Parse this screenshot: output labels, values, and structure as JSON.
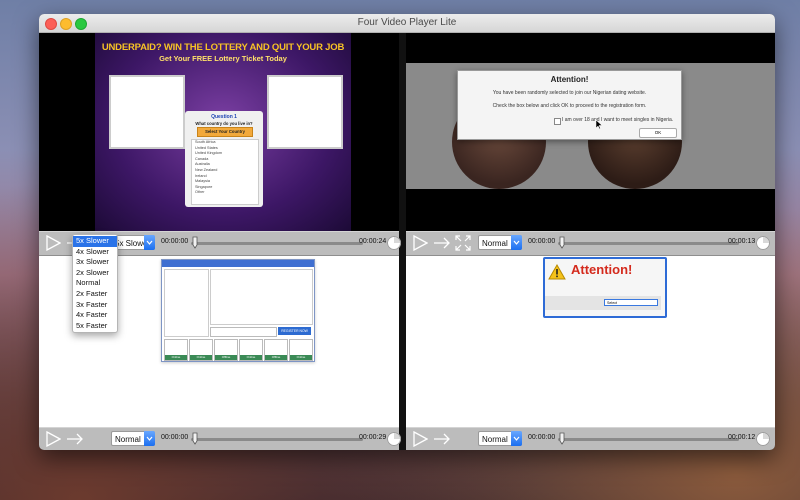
{
  "window": {
    "title": "Four Video Player Lite"
  },
  "players": [
    {
      "speed": "5x Slower",
      "time_elapsed": "00:00:00",
      "time_total": "00:00:24",
      "progress": 0
    },
    {
      "speed": "Normal",
      "time_elapsed": "00:00:00",
      "time_total": "00:00:13",
      "progress": 0
    },
    {
      "speed": "Normal",
      "time_elapsed": "00:00:00",
      "time_total": "00:00:29",
      "progress": 0
    },
    {
      "speed": "Normal",
      "time_elapsed": "00:00:00",
      "time_total": "00:00:12",
      "progress": 0
    }
  ],
  "speed_menu": {
    "selected": "5x Slower",
    "options": [
      "5x Slower",
      "4x Slower",
      "3x Slower",
      "2x Slower",
      "Normal",
      "2x Faster",
      "3x Faster",
      "4x Faster",
      "5x Faster"
    ]
  },
  "video1": {
    "headline": "UNDERPAID? WIN THE LOTTERY AND QUIT YOUR JOB",
    "subhead": "Get Your FREE Lottery Ticket Today",
    "question_title": "Question 1",
    "question": "What country do you live in?",
    "select_button": "Select Your Country",
    "countries": [
      "South Africa",
      "United States",
      "United Kingdom",
      "Canada",
      "Australia",
      "New Zealand",
      "Ireland",
      "Malaysia",
      "Singapore",
      "Other"
    ]
  },
  "video2": {
    "title": "Attention!",
    "line1": "You have been randomly selected to join our Nigerian dating website.",
    "line2": "Check the box below and click OK to proceed to the registration form.",
    "checkbox_label": "I am over 18 and I want to meet singles in Nigeria.",
    "ok_label": "OK"
  },
  "video3": {
    "register_label": "REGISTER NOW",
    "status_tags": [
      "Online",
      "Online",
      "Offline",
      "Online",
      "Offline",
      "Online"
    ]
  },
  "video4": {
    "title": "Attention!",
    "select_label": "Select"
  },
  "colors": {
    "accent": "#2a73e8",
    "attention_red": "#d42a1d",
    "headline_yellow": "#f7c325"
  }
}
